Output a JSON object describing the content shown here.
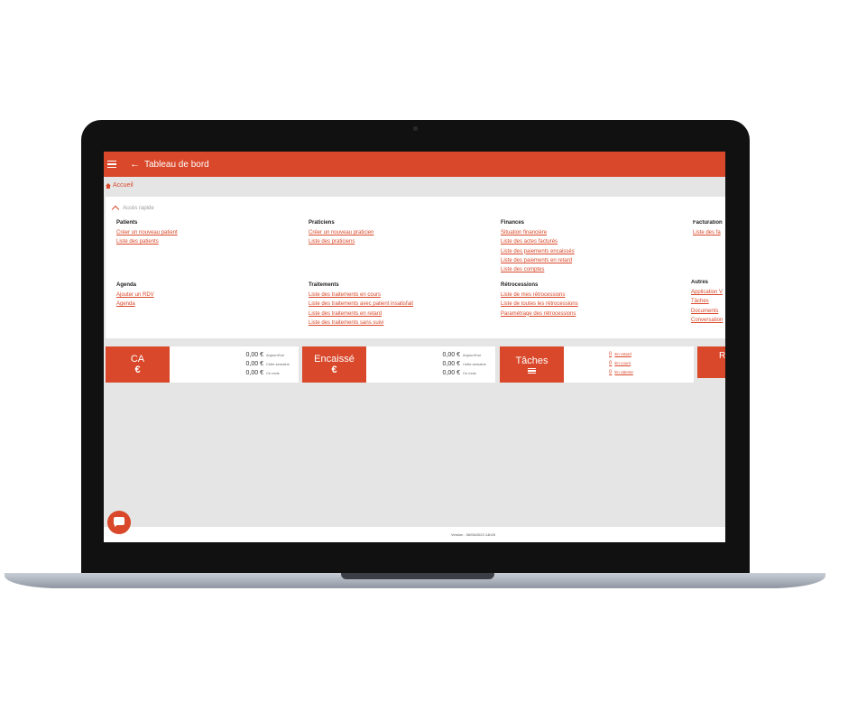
{
  "app": {
    "title": "Tableau de bord",
    "breadcrumb": "Accueil",
    "accent_color": "#d9482a"
  },
  "quick_access": {
    "label": "Accès rapide",
    "columns": [
      {
        "title": "Patients",
        "links": [
          "Créer un nouveau patient",
          "Liste des patients"
        ]
      },
      {
        "title": "Praticiens",
        "links": [
          "Créer un nouveau praticien",
          "Liste des praticiens"
        ]
      },
      {
        "title": "Finances",
        "links": [
          "Situation financière",
          "Liste des actes facturés",
          "Liste des paiements encaissés",
          "Liste des paiements en retard",
          "Liste des comptes"
        ]
      },
      {
        "title": "Facturation",
        "links": [
          "Liste des fa"
        ]
      },
      {
        "title": "Agenda",
        "links": [
          "Ajouter un RDV",
          "Agenda"
        ]
      },
      {
        "title": "Traitements",
        "links": [
          "Liste des traitements en cours",
          "Liste des traitements avec patient insatisfait",
          "Liste des traitements en retard",
          "Liste des traitements sans suivi"
        ]
      },
      {
        "title": "Rétrocessions",
        "links": [
          "Liste de mes rétrocessions",
          "Liste de toutes les rétrocessions",
          "Paramétrage des rétrocessions"
        ]
      },
      {
        "title": "Autres",
        "links": [
          "Application V",
          "Tâches",
          "Documents",
          "Conversation"
        ]
      }
    ]
  },
  "cards": {
    "ca": {
      "title": "CA",
      "symbol": "€",
      "stats": [
        {
          "value": "0,00 €",
          "label": "Aujourd'hui"
        },
        {
          "value": "0,00 €",
          "label": "Cette semaine"
        },
        {
          "value": "0,00 €",
          "label": "Ce mois"
        }
      ]
    },
    "encaisse": {
      "title": "Encaissé",
      "symbol": "€",
      "stats": [
        {
          "value": "0,00 €",
          "label": "Aujourd'hui"
        },
        {
          "value": "0,00 €",
          "label": "Cette semaine"
        },
        {
          "value": "0,00 €",
          "label": "Ce mois"
        }
      ]
    },
    "taches": {
      "title": "Tâches",
      "icon": "list-icon",
      "stats": [
        {
          "value": "0",
          "label": "En retard"
        },
        {
          "value": "0",
          "label": "En cours"
        },
        {
          "value": "0",
          "label": "En attente"
        }
      ]
    },
    "partial": {
      "title": "R"
    }
  },
  "footer": {
    "version": "Version : 06/06/2023 14h25"
  }
}
